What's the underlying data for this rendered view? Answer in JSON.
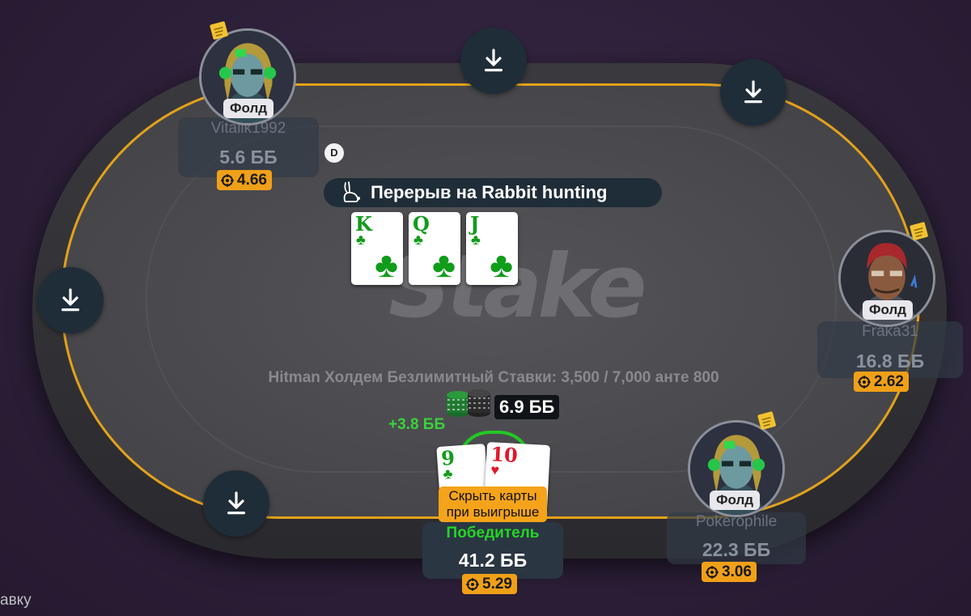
{
  "table": {
    "info": "Hitman Холдем Безлимитный Ставки: 3,500 / 7,000 анте 800",
    "logo": "Stake",
    "dealer_label": "D",
    "break_text": "Перерыв на Rabbit hunting",
    "pot": "6.9 ББ",
    "win_amount": "+3.8 ББ"
  },
  "board_cards": [
    {
      "rank": "K",
      "suit": "♣",
      "color": "green"
    },
    {
      "rank": "Q",
      "suit": "♣",
      "color": "green"
    },
    {
      "rank": "J",
      "suit": "♣",
      "color": "green"
    }
  ],
  "players": {
    "vitalik": {
      "name": "Vitalik1992",
      "stack": "5.6 ББ",
      "badge": "4.66",
      "status": "Фолд"
    },
    "fraka": {
      "name": "Fraka31",
      "stack": "16.8 ББ",
      "badge": "2.62",
      "status": "Фолд"
    },
    "pokerophile": {
      "name": "Pokerophile",
      "stack": "22.3 ББ",
      "badge": "3.06",
      "status": "Фолд"
    },
    "hero": {
      "status": "Победитель",
      "stack": "41.2 ББ",
      "badge": "5.29",
      "hide_cards_label": "Скрыть карты при выигрыше",
      "cards": [
        {
          "rank": "9",
          "suit": "♣",
          "color": "green"
        },
        {
          "rank": "10",
          "suit": "♥",
          "color": "red"
        }
      ]
    }
  },
  "corner_text": "авку",
  "colors": {
    "accent": "#f0a018",
    "rail": "#e3a21a",
    "winner": "#24d624",
    "seat": "#1f2d38"
  },
  "icons": [
    "download-icon",
    "rabbit-icon",
    "target-icon",
    "note-icon",
    "chips-icon"
  ]
}
